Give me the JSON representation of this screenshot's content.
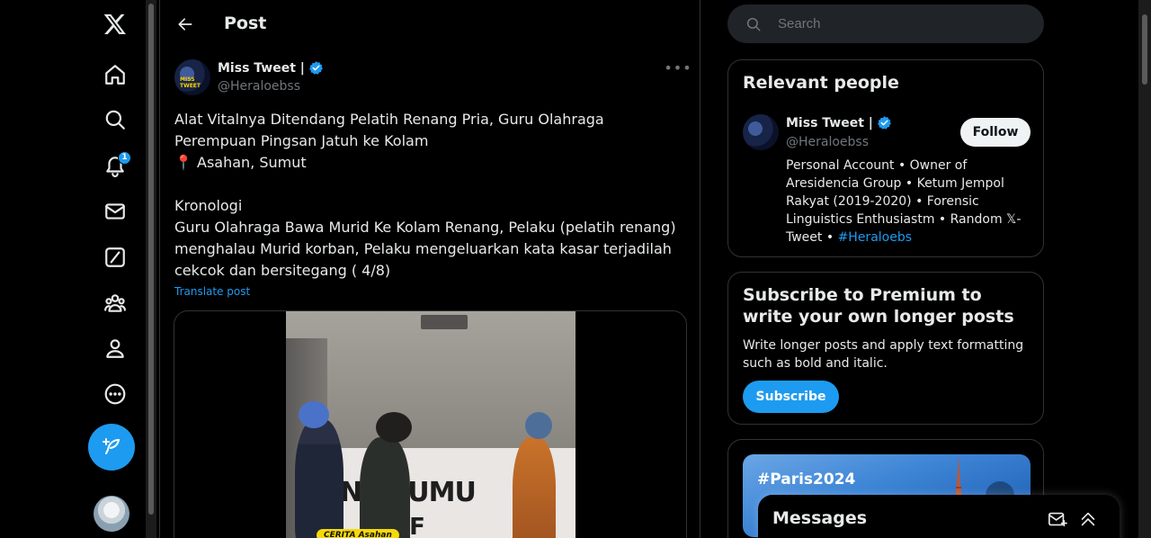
{
  "nav": {
    "logo": "x-logo-icon",
    "notification_count": "1",
    "items": [
      "home-icon",
      "explore-icon",
      "notifications-icon",
      "messages-icon",
      "grok-icon",
      "communities-icon",
      "profile-icon",
      "more-icon"
    ]
  },
  "header": {
    "title": "Post"
  },
  "post": {
    "author_name": "Miss Tweet |",
    "handle": "@Heraloebss",
    "avatar_text": "MISS TWEET",
    "text": "Alat Vitalnya Ditendang Pelatih Renang Pria, Guru Olahraga Perempuan Pingsan Jatuh ke Kolam\n📍 Asahan, Sumut\n\nKronologi\nGuru Olahraga Bawa Murid Ke Kolam Renang, Pelaku (pelatih renang) menghalau Murid korban, Pelaku mengeluarkan kata kasar terjadilah cekcok dan bersitegang ( 4/8)",
    "translate_label": "Translate post",
    "video_banner_line1": "N   KTUMU",
    "video_banner_line2": "ITIF",
    "video_caption": "CERITA  Asahan"
  },
  "search": {
    "placeholder": "Search"
  },
  "relevant_people": {
    "title": "Relevant people",
    "name": "Miss Tweet |",
    "handle": "@Heraloebss",
    "follow_label": "Follow",
    "bio": "Personal Account • Owner of Aresidencia Group • Ketum Jempol Rakyat (2019-2020) • Forensic Linguistics Enthusiastm • Random 𝕏-Tweet • ",
    "bio_tag": "#Heraloebs"
  },
  "premium": {
    "title": "Subscribe to Premium to write your own longer posts",
    "description": "Write longer posts and apply text formatting such as bold and italic.",
    "button": "Subscribe"
  },
  "trend": {
    "label": "#Paris2024"
  },
  "messages": {
    "title": "Messages"
  },
  "colors": {
    "accent": "#1d9bf0",
    "background": "#000000",
    "border": "#2f3336",
    "muted": "#71767b"
  }
}
